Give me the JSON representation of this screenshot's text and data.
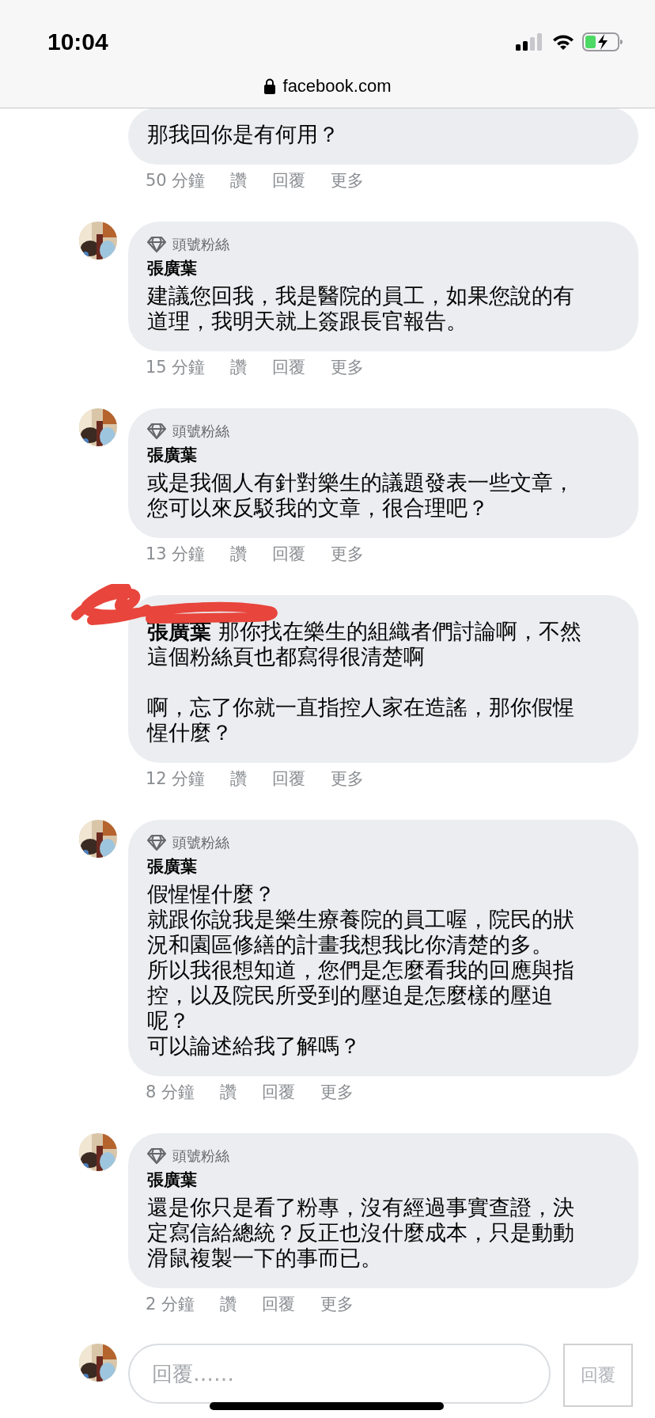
{
  "status_bar": {
    "time": "10:04"
  },
  "address_bar": {
    "url": "facebook.com"
  },
  "comments": [
    {
      "redacted": false,
      "paragraphs": [
        "那我回你是有何用？"
      ],
      "time": "50 分鐘",
      "actions": [
        "讚",
        "回覆",
        "更多"
      ]
    },
    {
      "redacted": false,
      "badge": "頭號粉絲",
      "author": "張廣葉",
      "paragraphs": [
        "建議您回我，我是醫院的員工，如果您說的有道理，我明天就上簽跟長官報告。"
      ],
      "time": "15 分鐘",
      "actions": [
        "讚",
        "回覆",
        "更多"
      ]
    },
    {
      "redacted": false,
      "badge": "頭號粉絲",
      "author": "張廣葉",
      "paragraphs": [
        "或是我個人有針對樂生的議題發表一些文章，您可以來反駁我的文章，很合理吧？"
      ],
      "time": "13 分鐘",
      "actions": [
        "讚",
        "回覆",
        "更多"
      ]
    },
    {
      "redacted": true,
      "spaced": true,
      "paragraphs": [
        "**張廣葉** 那你找在樂生的組織者們討論啊，不然這個粉絲頁也都寫得很清楚啊",
        "啊，忘了你就一直指控人家在造謠，那你假惺惺什麼？"
      ],
      "time": "12 分鐘",
      "actions": [
        "讚",
        "回覆",
        "更多"
      ]
    },
    {
      "redacted": false,
      "spaced": false,
      "badge": "頭號粉絲",
      "author": "張廣葉",
      "paragraphs": [
        "假惺惺什麼？",
        "就跟你說我是樂生療養院的員工喔，院民的狀況和園區修繕的計畫我想我比你清楚的多。",
        "所以我很想知道，您們是怎麼看我的回應與指控，以及院民所受到的壓迫是怎麼樣的壓迫呢？",
        "可以論述給我了解嗎？"
      ],
      "time": "8 分鐘",
      "actions": [
        "讚",
        "回覆",
        "更多"
      ]
    },
    {
      "redacted": false,
      "badge": "頭號粉絲",
      "author": "張廣葉",
      "paragraphs": [
        "還是你只是看了粉專，沒有經過事實查證，決定寫信給總統？反正也沒什麼成本，只是動動滑鼠複製一下的事而已。"
      ],
      "time": "2 分鐘",
      "actions": [
        "讚",
        "回覆",
        "更多"
      ]
    }
  ],
  "reply_bar": {
    "placeholder": "回覆……",
    "button": "回覆"
  }
}
